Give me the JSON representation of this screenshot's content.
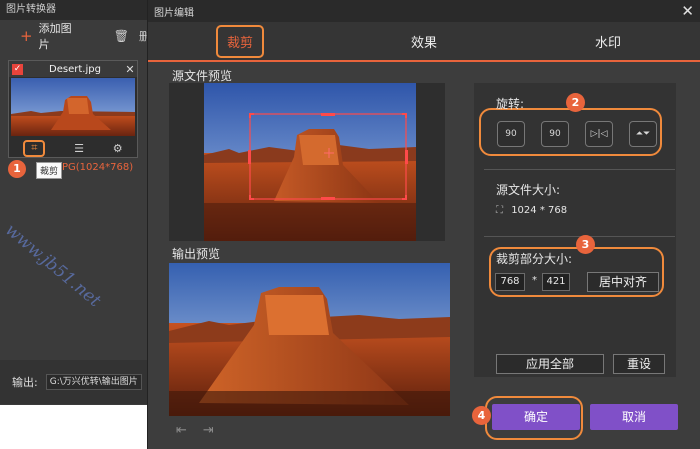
{
  "converter": {
    "title": "图片转换器",
    "add_label": "添加图片",
    "delete_tail": "删",
    "file": {
      "name": "Desert.jpg",
      "info": "PG(1024*768)",
      "tooltip": "裁剪"
    },
    "output_label": "输出:",
    "output_path": "G:\\万兴优转\\输出图片"
  },
  "watermark_text": "www.jb51.net",
  "editor": {
    "title": "图片编辑",
    "tabs": [
      "裁剪",
      "效果",
      "水印"
    ],
    "source_preview_label": "源文件预览",
    "output_preview_label": "输出预览",
    "rotate_label": "旋转:",
    "rotate_buttons": [
      "90",
      "90",
      "",
      ""
    ],
    "source_size_label": "源文件大小:",
    "source_size_value": "1024 * 768",
    "crop_size_label": "裁剪部分大小:",
    "crop_width": "768",
    "crop_sep": "*",
    "crop_height": "421",
    "center_button": "居中对齐",
    "apply_all_button": "应用全部",
    "reset_button": "重设",
    "ok_button": "确定",
    "cancel_button": "取消"
  },
  "badges": [
    "1",
    "2",
    "3",
    "4"
  ],
  "colors": {
    "accent": "#e8643c",
    "highlight_outline": "#f08a3c",
    "primary_button": "#8050c8",
    "dialog_bg": "#3d3d3d"
  }
}
